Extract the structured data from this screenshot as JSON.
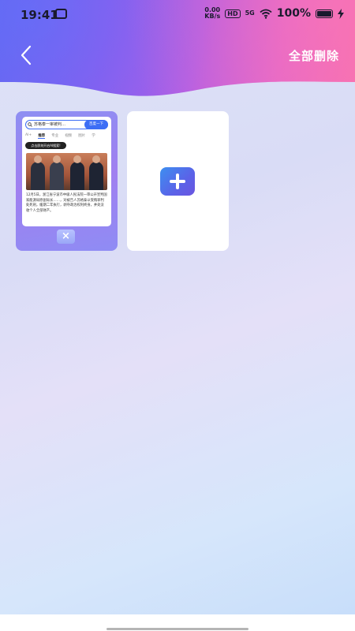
{
  "status_bar": {
    "time": "19:41",
    "net_speed_value": "0.00",
    "net_speed_unit": "KB/s",
    "hd": "HD",
    "signal": "5G",
    "battery": "100%"
  },
  "header": {
    "delete_all_label": "全部删除"
  },
  "tabs": [
    {
      "preview": {
        "search_text": "苏格泰一审被判…",
        "search_button": "百度一下",
        "tabs": [
          "AI+",
          "推荐",
          "专业",
          "视频",
          "图片",
          "学"
        ],
        "tooltip": "点击即刻开启AI搜索!",
        "article_text": "12月5日，浙江省宁波市中级人民法院一审公开宣判国家能源局原副局长……，对被告人苏格泰以受贿罪判处死刑，缓期二年执行，剥夺政治权利终身，并处没收个人全部财产。"
      },
      "close_glyph": "×"
    }
  ],
  "colors": {
    "accent": "#3d6ef5",
    "header_start": "#6a63ef",
    "header_end": "#f46fb0"
  },
  "icons": {
    "back": "chevron-left-icon",
    "add": "plus-icon",
    "close": "close-icon"
  }
}
